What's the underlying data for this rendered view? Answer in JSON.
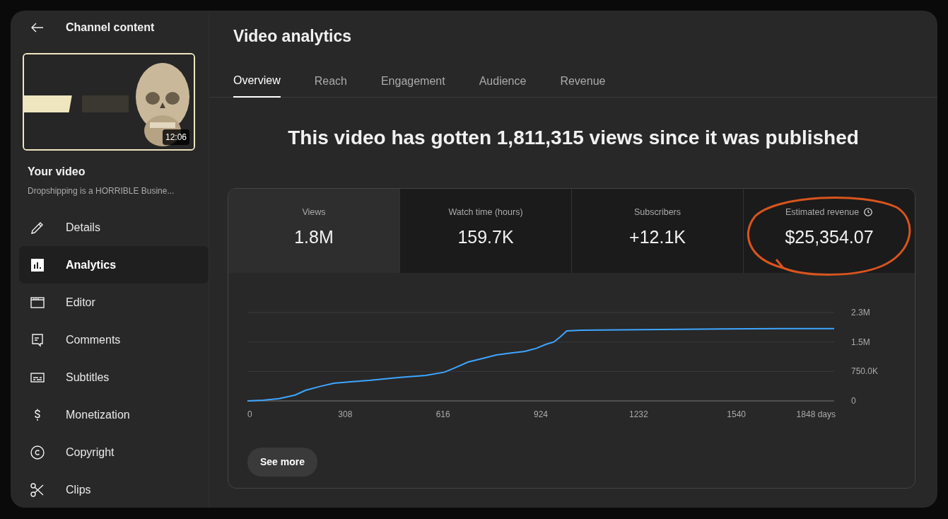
{
  "sidebar": {
    "back_title": "Channel content",
    "thumbnail": {
      "kind": "picture",
      "duration": "12:06"
    },
    "video_label": "Your video",
    "video_title": "Dropshipping is a HORRIBLE Busine...",
    "items": [
      {
        "label": "Details",
        "selected": false
      },
      {
        "label": "Analytics",
        "selected": true
      },
      {
        "label": "Editor",
        "selected": false
      },
      {
        "label": "Comments",
        "selected": false
      },
      {
        "label": "Subtitles",
        "selected": false
      },
      {
        "label": "Monetization",
        "selected": false
      },
      {
        "label": "Copyright",
        "selected": false
      },
      {
        "label": "Clips",
        "selected": false
      }
    ]
  },
  "page_title": "Video analytics",
  "tabs": [
    {
      "label": "Overview",
      "selected": true
    },
    {
      "label": "Reach",
      "selected": false
    },
    {
      "label": "Engagement",
      "selected": false
    },
    {
      "label": "Audience",
      "selected": false
    },
    {
      "label": "Revenue",
      "selected": false
    }
  ],
  "headline": "This video has gotten 1,811,315 views since it was published",
  "metrics": [
    {
      "label": "Views",
      "value": "1.8M",
      "selected": true
    },
    {
      "label": "Watch time (hours)",
      "value": "159.7K",
      "selected": false
    },
    {
      "label": "Subscribers",
      "value": "+12.1K",
      "selected": false
    },
    {
      "label": "Estimated revenue",
      "value": "$25,354.07",
      "selected": false,
      "clock": true,
      "circled": true
    }
  ],
  "chart": {
    "chart_data": {
      "type": "line",
      "x": [
        0,
        50,
        100,
        150,
        183,
        230,
        272,
        330,
        383,
        480,
        561,
        620,
        650,
        695,
        740,
        784,
        830,
        873,
        910,
        940,
        965,
        984,
        1006,
        1051,
        1296,
        1686,
        1848
      ],
      "series": [
        {
          "color": "#3ea6ff",
          "values": [
            0,
            20000,
            60000,
            150000,
            270000,
            370000,
            450000,
            490000,
            520000,
            600000,
            650000,
            730000,
            830000,
            990000,
            1080000,
            1170000,
            1220000,
            1260000,
            1340000,
            1440000,
            1500000,
            1620000,
            1780000,
            1800000,
            1820000,
            1840000,
            1840000
          ]
        }
      ],
      "xlim": [
        0,
        1848
      ],
      "ylim": [
        0,
        2250000
      ],
      "xticks": [
        0,
        308,
        616,
        924,
        1232,
        1540,
        {
          "value": 1848,
          "label": "1848 days"
        }
      ],
      "yticks": [
        0,
        {
          "value": 750000,
          "label": "750.0K"
        },
        {
          "value": 1500000,
          "label": "1.5M"
        },
        {
          "value": 2250000,
          "label": "2.3M"
        }
      ]
    }
  },
  "see_more": "See more"
}
